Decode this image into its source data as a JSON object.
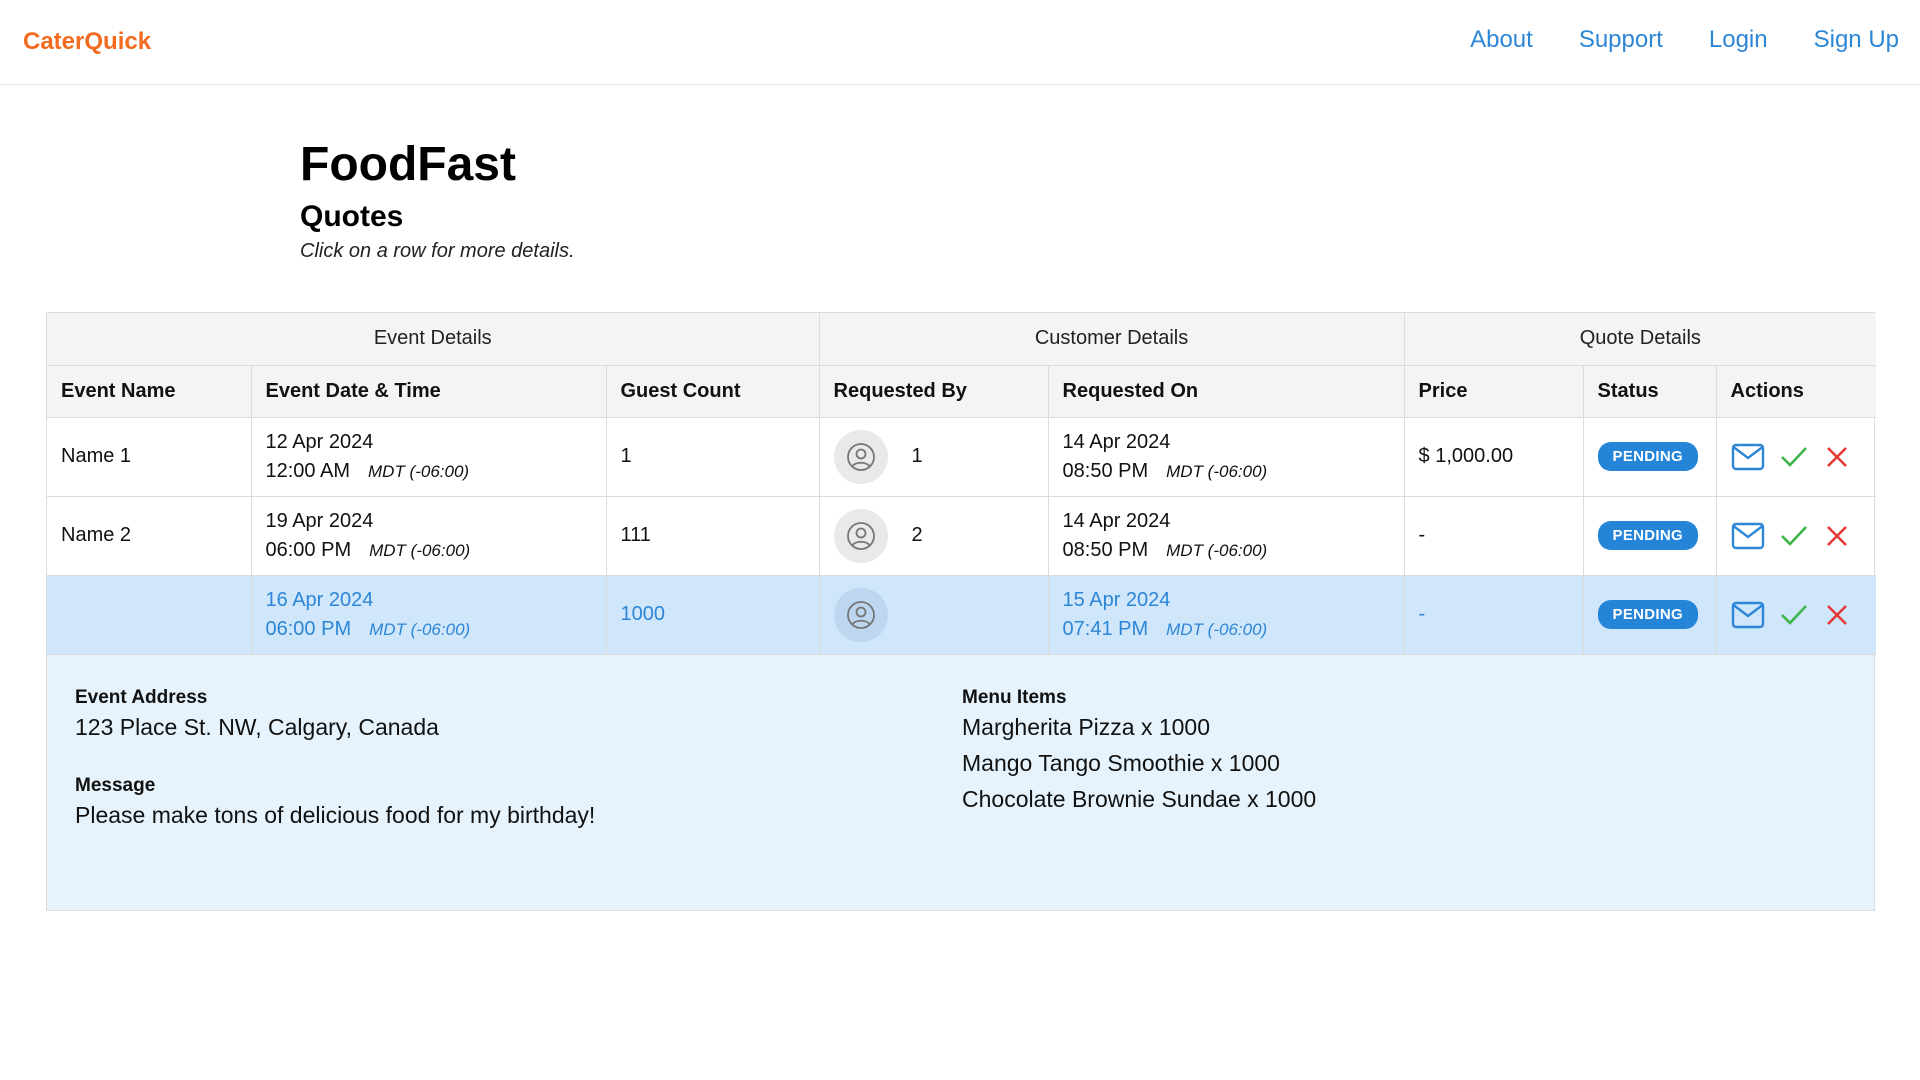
{
  "header": {
    "brand": "CaterQuick",
    "nav": {
      "about": "About",
      "support": "Support",
      "login": "Login",
      "signup": "Sign Up"
    }
  },
  "page": {
    "title": "FoodFast",
    "subtitle": "Quotes",
    "hint": "Click on a row for more details."
  },
  "table": {
    "groups": {
      "event": "Event Details",
      "customer": "Customer Details",
      "quote": "Quote Details"
    },
    "columns": {
      "event_name": "Event Name",
      "event_datetime": "Event Date & Time",
      "guest_count": "Guest Count",
      "requested_by": "Requested By",
      "requested_on": "Requested On",
      "price": "Price",
      "status": "Status",
      "actions": "Actions"
    },
    "rows": [
      {
        "name": "Name 1",
        "event_date": "12 Apr 2024",
        "event_time": "12:00 AM",
        "event_tz": "MDT (-06:00)",
        "guests": "1",
        "requested_by": "1",
        "req_date": "14 Apr 2024",
        "req_time": "08:50 PM",
        "req_tz": "MDT (-06:00)",
        "price": "$ 1,000.00",
        "status": "PENDING"
      },
      {
        "name": "Name 2",
        "event_date": "19 Apr 2024",
        "event_time": "06:00 PM",
        "event_tz": "MDT (-06:00)",
        "guests": "111",
        "requested_by": "2",
        "req_date": "14 Apr 2024",
        "req_time": "08:50 PM",
        "req_tz": "MDT (-06:00)",
        "price": "-",
        "status": "PENDING"
      },
      {
        "name": "",
        "event_date": "16 Apr 2024",
        "event_time": "06:00 PM",
        "event_tz": "MDT (-06:00)",
        "guests": "1000",
        "requested_by": "",
        "req_date": "15 Apr 2024",
        "req_time": "07:41 PM",
        "req_tz": "MDT (-06:00)",
        "price": "-",
        "status": "PENDING"
      }
    ]
  },
  "detail": {
    "address_label": "Event Address",
    "address": "123 Place St. NW, Calgary, Canada",
    "message_label": "Message",
    "message": "Please make tons of delicious food for my birthday!",
    "menu_label": "Menu Items",
    "menu_items": [
      "Margherita Pizza x 1000",
      "Mango Tango Smoothie x 1000",
      "Chocolate Brownie Sundae x 1000"
    ]
  },
  "colors": {
    "brand": "#f26b21",
    "link": "#2d86d6",
    "badge": "#2485d8",
    "approve": "#3cb54a",
    "reject": "#e53935",
    "selected_row": "#cfe6fb",
    "detail_bg": "#e6f3fc"
  },
  "icons": {
    "avatar": "user-circle-icon",
    "email": "envelope-icon",
    "approve": "check-icon",
    "reject": "close-icon"
  }
}
